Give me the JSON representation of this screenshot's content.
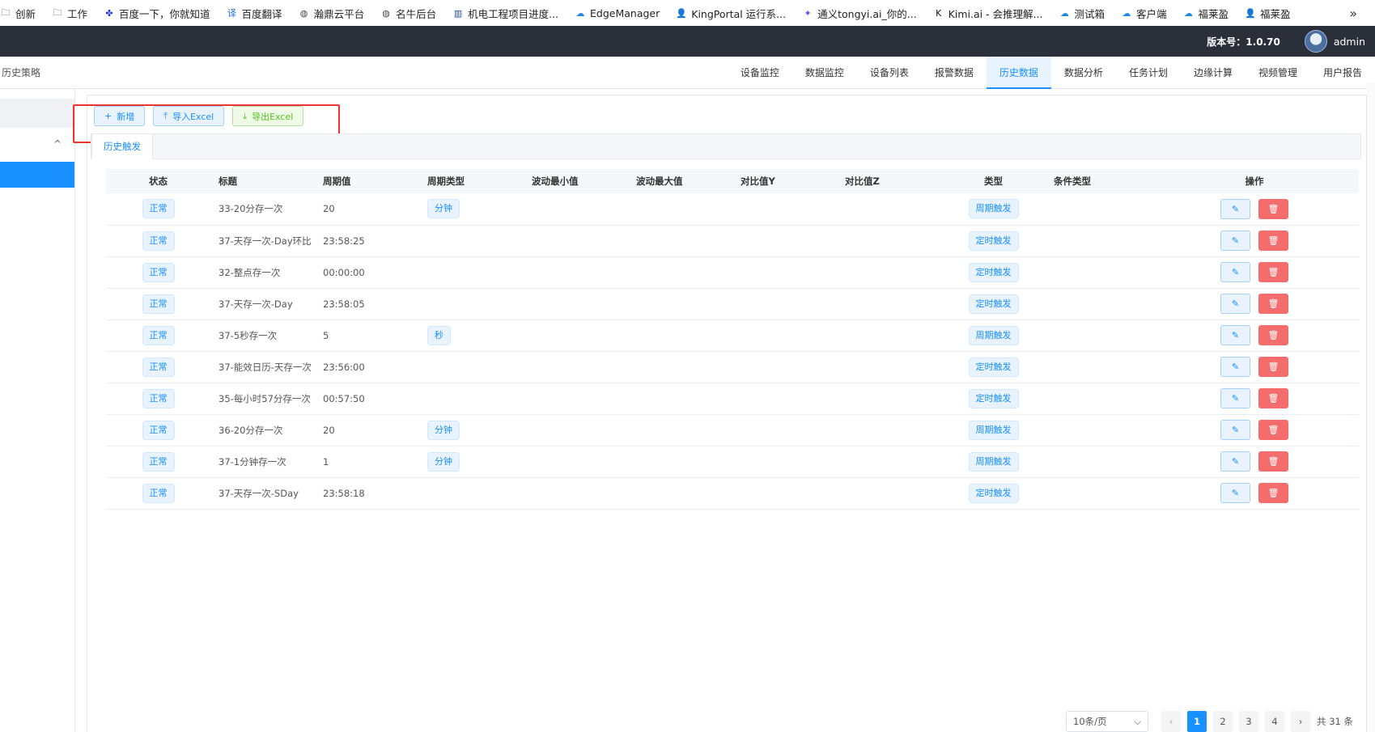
{
  "bookmarks": [
    {
      "label": "创新",
      "icon": "folder-icon",
      "color": "#333333"
    },
    {
      "label": "工作",
      "icon": "folder-icon",
      "color": "#333333"
    },
    {
      "label": "百度一下，你就知道",
      "icon": "baidu-paw-icon",
      "color": "#2932e1"
    },
    {
      "label": "百度翻译",
      "icon": "baidu-translate-icon",
      "color": "#1e6cf2"
    },
    {
      "label": "瀚鼎云平台",
      "icon": "globe-icon",
      "color": "#444444"
    },
    {
      "label": "名牛后台",
      "icon": "globe-icon",
      "color": "#444444"
    },
    {
      "label": "机电工程项目进度...",
      "icon": "chart-logo-icon",
      "color": "#1a4b9c"
    },
    {
      "label": "EdgeManager",
      "icon": "cloud-icon",
      "color": "#1e88e5"
    },
    {
      "label": "KingPortal 运行系...",
      "icon": "person-icon",
      "color": "#1e88e5"
    },
    {
      "label": "通义tongyi.ai_你的...",
      "icon": "tongyi-icon",
      "color": "#6a4cf0"
    },
    {
      "label": "Kimi.ai - 会推理解...",
      "icon": "kimi-icon",
      "color": "#111111"
    },
    {
      "label": "测试箱",
      "icon": "cloud-icon",
      "color": "#1e88e5"
    },
    {
      "label": "客户端",
      "icon": "cloud-icon",
      "color": "#1e88e5"
    },
    {
      "label": "福莱盈",
      "icon": "cloud-icon",
      "color": "#1e88e5"
    },
    {
      "label": "福莱盈",
      "icon": "person-icon",
      "color": "#1e88e5"
    }
  ],
  "bookmarks_more": "»",
  "header": {
    "version": "版本号：1.0.70",
    "user": "admin"
  },
  "breadcrumb": "历史策略",
  "nav_tabs": [
    {
      "label": "设备监控",
      "active": false
    },
    {
      "label": "数据监控",
      "active": false
    },
    {
      "label": "设备列表",
      "active": false
    },
    {
      "label": "报警数据",
      "active": false
    },
    {
      "label": "历史数据",
      "active": true
    },
    {
      "label": "数据分析",
      "active": false
    },
    {
      "label": "任务计划",
      "active": false
    },
    {
      "label": "边缘计算",
      "active": false
    },
    {
      "label": "视频管理",
      "active": false
    },
    {
      "label": "用户报告",
      "active": false
    }
  ],
  "sidebar": {
    "collapse_glyph": "^"
  },
  "toolbar": {
    "add_label": "新增",
    "import_label": "导入Excel",
    "export_label": "导出Excel"
  },
  "subtab": "历史触发",
  "table": {
    "columns": [
      "状态",
      "标题",
      "周期值",
      "周期类型",
      "波动最小值",
      "波动最大值",
      "对比值Y",
      "对比值Z",
      "类型",
      "条件类型",
      "操作"
    ],
    "rows": [
      {
        "status": "正常",
        "title": "33-20分存一次",
        "period": "20",
        "period_type": "分钟",
        "min": "",
        "max": "",
        "y": "",
        "z": "",
        "type": "周期触发",
        "cond": ""
      },
      {
        "status": "正常",
        "title": "37-天存一次-Day环比",
        "period": "23:58:25",
        "period_type": "",
        "min": "",
        "max": "",
        "y": "",
        "z": "",
        "type": "定时触发",
        "cond": ""
      },
      {
        "status": "正常",
        "title": "32-整点存一次",
        "period": "00:00:00",
        "period_type": "",
        "min": "",
        "max": "",
        "y": "",
        "z": "",
        "type": "定时触发",
        "cond": ""
      },
      {
        "status": "正常",
        "title": "37-天存一次-Day",
        "period": "23:58:05",
        "period_type": "",
        "min": "",
        "max": "",
        "y": "",
        "z": "",
        "type": "定时触发",
        "cond": ""
      },
      {
        "status": "正常",
        "title": "37-5秒存一次",
        "period": "5",
        "period_type": "秒",
        "min": "",
        "max": "",
        "y": "",
        "z": "",
        "type": "周期触发",
        "cond": ""
      },
      {
        "status": "正常",
        "title": "37-能效日历-天存一次",
        "period": "23:56:00",
        "period_type": "",
        "min": "",
        "max": "",
        "y": "",
        "z": "",
        "type": "定时触发",
        "cond": ""
      },
      {
        "status": "正常",
        "title": "35-每小时57分存一次",
        "period": "00:57:50",
        "period_type": "",
        "min": "",
        "max": "",
        "y": "",
        "z": "",
        "type": "定时触发",
        "cond": ""
      },
      {
        "status": "正常",
        "title": "36-20分存一次",
        "period": "20",
        "period_type": "分钟",
        "min": "",
        "max": "",
        "y": "",
        "z": "",
        "type": "周期触发",
        "cond": ""
      },
      {
        "status": "正常",
        "title": "37-1分钟存一次",
        "period": "1",
        "period_type": "分钟",
        "min": "",
        "max": "",
        "y": "",
        "z": "",
        "type": "周期触发",
        "cond": ""
      },
      {
        "status": "正常",
        "title": "37-天存一次-SDay",
        "period": "23:58:18",
        "period_type": "",
        "min": "",
        "max": "",
        "y": "",
        "z": "",
        "type": "定时触发",
        "cond": ""
      }
    ]
  },
  "pagination": {
    "page_size": "10条/页",
    "pages": [
      "1",
      "2",
      "3",
      "4"
    ],
    "current": "1",
    "total": "共 31 条",
    "prev": "‹",
    "next": "›"
  },
  "colors": {
    "primary": "#1890ff",
    "danger": "#f56c6c",
    "success": "#52c41a",
    "header_bg": "#2b2f3a",
    "highlight": "#e33333"
  }
}
